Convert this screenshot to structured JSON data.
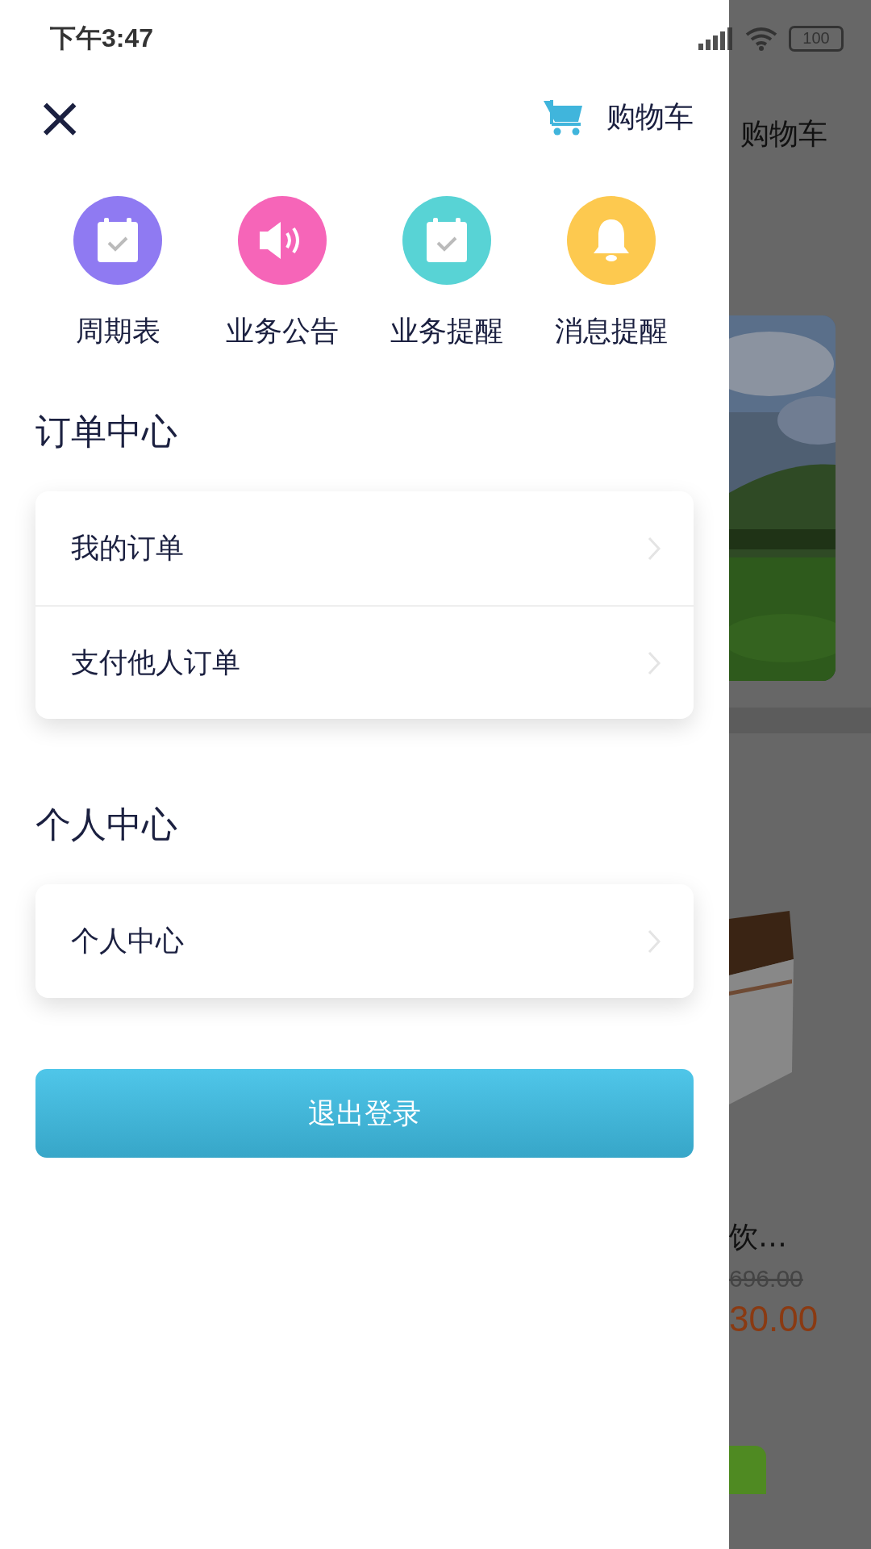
{
  "status_bar": {
    "time": "下午3:47",
    "battery": "100"
  },
  "drawer": {
    "close": "×",
    "cart_label": "购物车",
    "shortcuts": [
      {
        "label": "周期表",
        "kind": "calendar",
        "color": "#8f7af2"
      },
      {
        "label": "业务公告",
        "kind": "speaker",
        "color": "#f665b8"
      },
      {
        "label": "业务提醒",
        "kind": "calendar",
        "color": "#58d3d5"
      },
      {
        "label": "消息提醒",
        "kind": "bell",
        "color": "#fdc94f"
      }
    ],
    "sections": [
      {
        "title": "订单中心",
        "items": [
          "我的订单",
          "支付他人订单"
        ]
      },
      {
        "title": "个人中心",
        "items": [
          "个人中心"
        ]
      }
    ],
    "logout": "退出登录"
  },
  "background_page": {
    "title": "购物车",
    "product_name": "饮…",
    "original_price": "696.00",
    "price": "30.00"
  }
}
